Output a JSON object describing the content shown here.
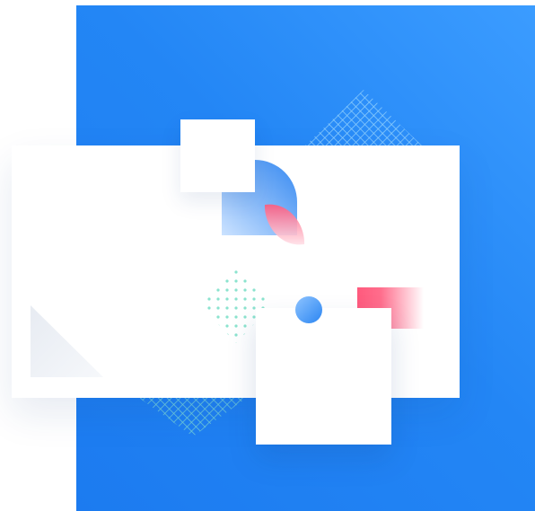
{
  "illustration": {
    "kind": "abstract-geometric-illustration",
    "colors": {
      "background_blue_light": "#3b9cff",
      "background_blue_dark": "#1c7bf0",
      "card_white": "#ffffff",
      "accent_pink": "#ff5a7d",
      "accent_blue": "#2b86f2",
      "pattern_teal": "#7ee0c8",
      "pattern_light_blue": "#9fd8ff",
      "triangle_grey": "#eef1f6"
    },
    "shapes": [
      "blue-gradient-backdrop",
      "white-landscape-card",
      "white-small-square",
      "blue-quarter-shape",
      "pink-leaf-shape",
      "teal-dot-pattern",
      "cyan-crosshatch-pattern",
      "grey-triangle",
      "blue-circle",
      "pink-gradient-rectangle",
      "white-bottom-square"
    ]
  }
}
